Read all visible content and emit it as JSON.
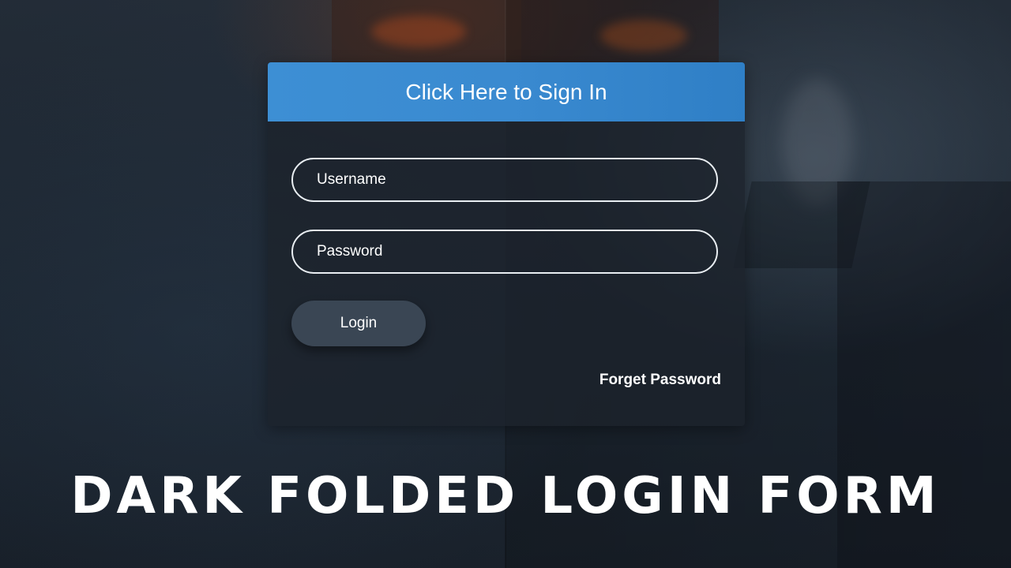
{
  "colors": {
    "accent": "#3a8ad0",
    "card_bg": "#1c232c",
    "button_bg": "#3a4654",
    "text": "#ffffff"
  },
  "form": {
    "header": "Click Here to Sign In",
    "username_placeholder": "Username",
    "password_placeholder": "Password",
    "login_label": "Login",
    "forget_label": "Forget Password"
  },
  "banner": {
    "title": "DARK FOLDED LOGIN FORM"
  }
}
